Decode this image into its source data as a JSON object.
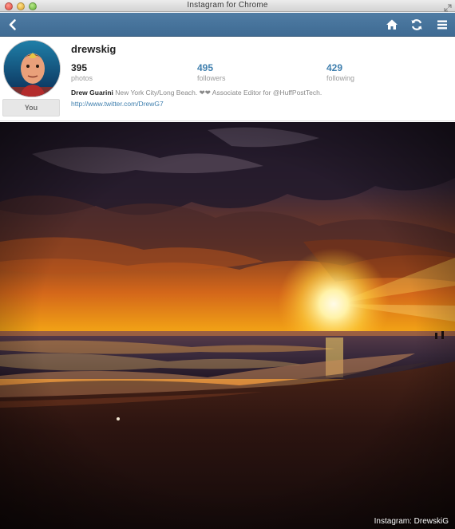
{
  "window": {
    "title": "Instagram for Chrome"
  },
  "nav": {
    "back_icon": "chevron-left-icon",
    "home_icon": "home-icon",
    "refresh_icon": "refresh-icon",
    "menu_icon": "hamburger-menu-icon",
    "bar_color": "#44719a"
  },
  "profile": {
    "username": "drewskig",
    "you_label": "You",
    "stats": {
      "photos": {
        "value": "395",
        "label": "photos"
      },
      "followers": {
        "value": "495",
        "label": "followers"
      },
      "following": {
        "value": "429",
        "label": "following"
      }
    },
    "bio_name": "Drew Guarini",
    "bio_text": " New York City/Long Beach. ❤❤ Associate Editor for @HuffPostTech.",
    "link": "http://www.twitter.com/DrewG7",
    "link_color": "#3f7fae"
  },
  "photo": {
    "credit": "Instagram: DrewskiG"
  }
}
